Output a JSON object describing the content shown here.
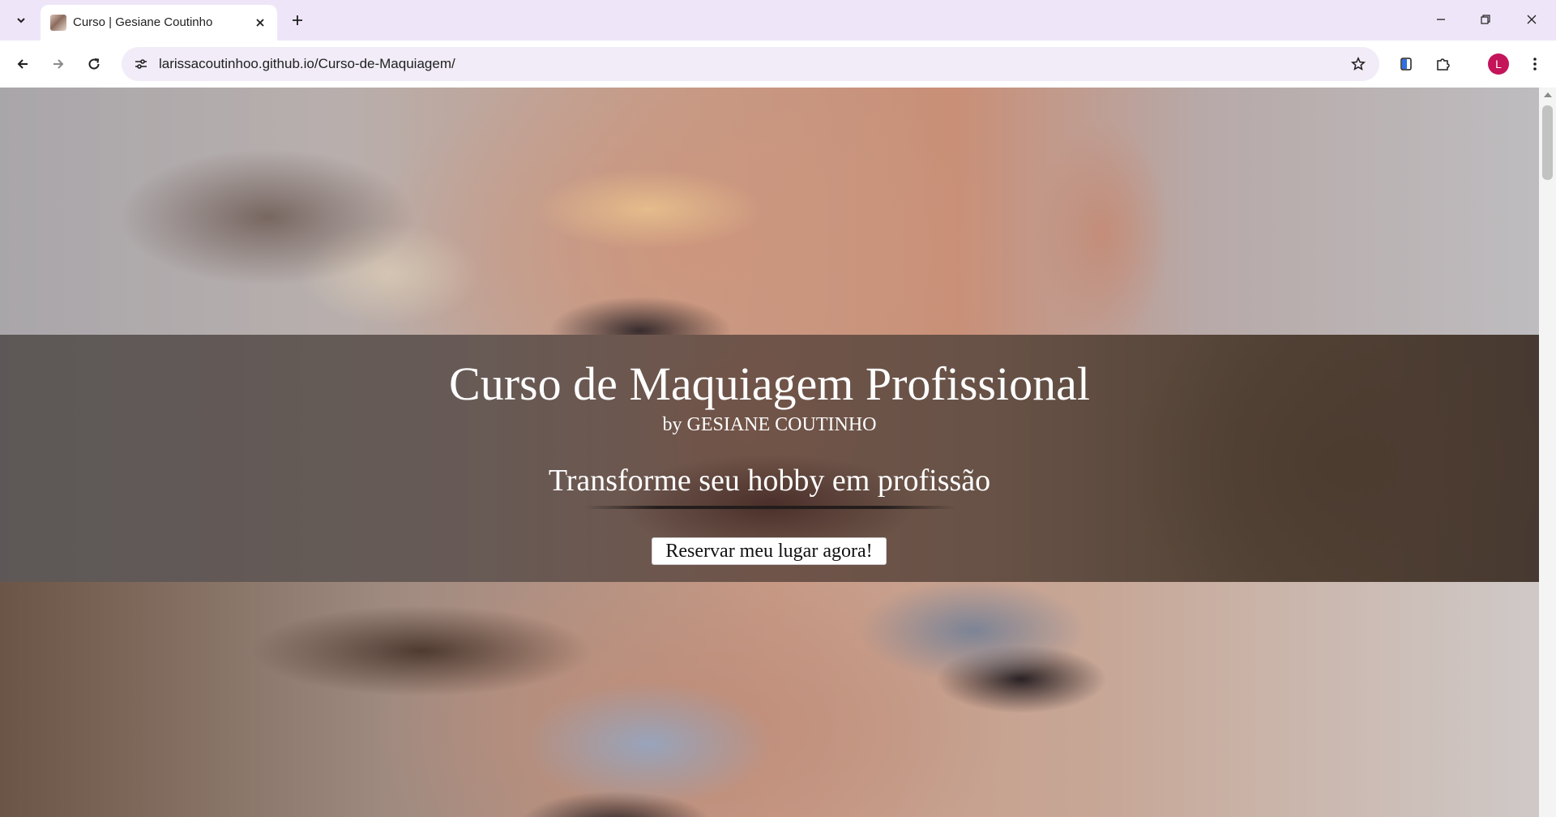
{
  "browser": {
    "tab": {
      "title": "Curso | Gesiane Coutinho"
    },
    "url": "larissacoutinhoo.github.io/Curso-de-Maquiagem/",
    "profile_initial": "L"
  },
  "icons": {
    "tab_search": "chevron-down-icon",
    "tab_close": "close-icon",
    "new_tab": "plus-icon",
    "minimize": "minimize-icon",
    "restore": "restore-icon",
    "close_window": "close-icon",
    "back": "arrow-left-icon",
    "forward": "arrow-right-icon",
    "reload": "reload-icon",
    "site_info": "tune-icon",
    "bookmark": "star-icon",
    "sidepanel": "side-panel-icon",
    "extensions": "puzzle-icon",
    "menu": "kebab-menu-icon"
  },
  "hero": {
    "title": "Curso de Maquiagem Profissional",
    "byline": "by GESIANE COUTINHO",
    "tagline": "Transforme seu hobby em profissão",
    "cta_label": "Reservar meu lugar agora!"
  },
  "colors": {
    "tabstrip_bg": "#eee6f8",
    "omnibox_bg": "#f1ecf7",
    "avatar_bg": "#c4145a",
    "overlay": "rgba(40,38,36,0.55)"
  }
}
